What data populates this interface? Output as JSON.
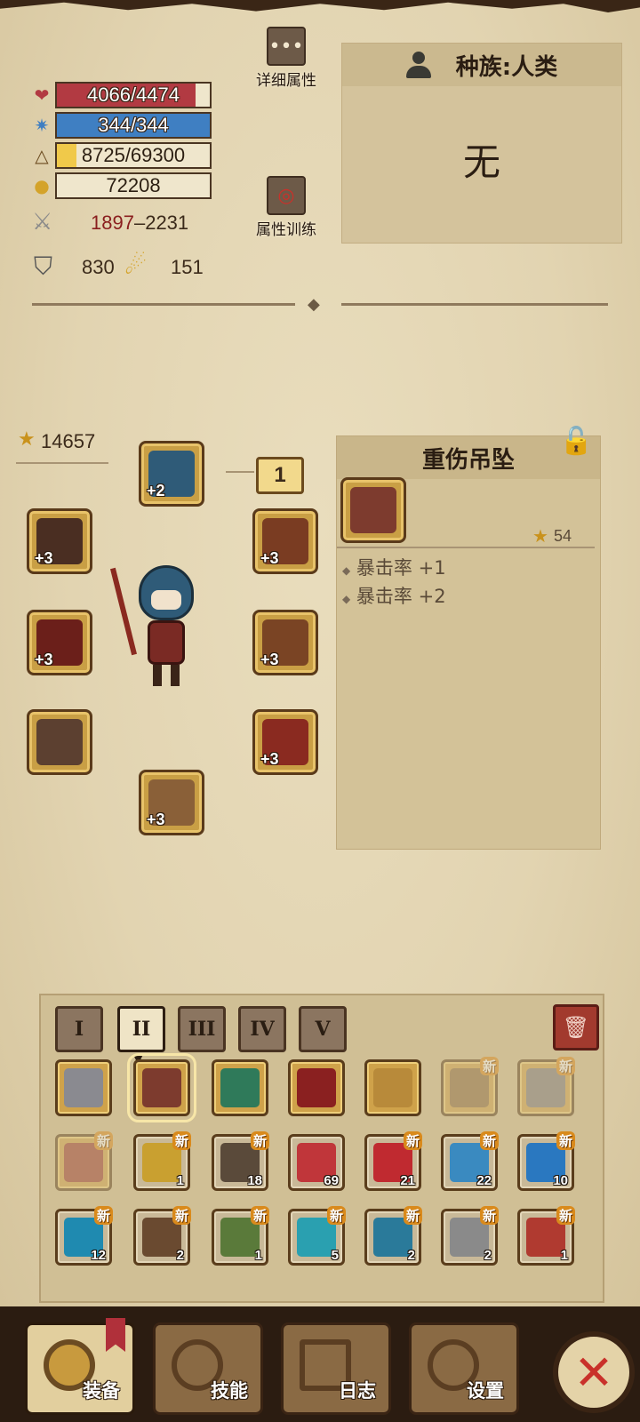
{
  "stats": {
    "hp": "4066/4474",
    "hp_fraction": 0.909,
    "mp": "344/344",
    "mp_fraction": 1.0,
    "xp": "8725/69300",
    "xp_fraction": 0.126,
    "gold": "72208",
    "attack_min": "1897",
    "attack_sep": "–",
    "attack_max": "2231",
    "armor": "830",
    "dodge": "151"
  },
  "buttons": {
    "details_label": "详细属性",
    "training_label": "属性训练"
  },
  "race": {
    "title": "种族:人类",
    "value": "无"
  },
  "equipment": {
    "total_power": "14657",
    "level_badge": "1",
    "slots": [
      {
        "name": "helmet",
        "plus": "+2",
        "color": "#2f5b78"
      },
      {
        "name": "gloves",
        "plus": "+3",
        "color": "#4a2e22"
      },
      {
        "name": "necklace",
        "plus": "+3",
        "color": "#7a3c22"
      },
      {
        "name": "weapon",
        "plus": "+3",
        "color": "#6b1f1a"
      },
      {
        "name": "armor",
        "plus": "+3",
        "color": "#7a4424"
      },
      {
        "name": "offhand",
        "plus": "",
        "color": "#5c4030"
      },
      {
        "name": "cloak",
        "plus": "+3",
        "color": "#8a2a20"
      },
      {
        "name": "boots",
        "plus": "+3",
        "color": "#8a6038"
      }
    ]
  },
  "detail": {
    "title": "重伤吊坠",
    "stars": "54",
    "attrs": [
      "暴击率 +1",
      "暴击率 +2"
    ]
  },
  "inventory": {
    "tabs": [
      "I",
      "II",
      "III",
      "IV",
      "V"
    ],
    "active_tab": 1,
    "new_label": "新",
    "rows": [
      [
        {
          "color": "#8a8a90",
          "count": "",
          "new": false,
          "faded": false,
          "gold": true
        },
        {
          "color": "#7d3b2e",
          "count": "",
          "new": false,
          "faded": false,
          "gold": true,
          "selected": true
        },
        {
          "color": "#2f7a5a",
          "count": "",
          "new": false,
          "faded": false,
          "gold": true
        },
        {
          "color": "#8a2020",
          "count": "",
          "new": false,
          "faded": false,
          "gold": true
        },
        {
          "color": "#b88a3a",
          "count": "",
          "new": false,
          "faded": false,
          "gold": true
        },
        {
          "color": "#8a6a40",
          "count": "",
          "new": true,
          "faded": true,
          "gold": true
        },
        {
          "color": "#7a7a80",
          "count": "",
          "new": true,
          "faded": true,
          "gold": true
        }
      ],
      [
        {
          "color": "#9a3a30",
          "count": "",
          "new": true,
          "faded": true,
          "gold": true
        },
        {
          "color": "#c9a030",
          "count": "1",
          "new": true,
          "faded": false,
          "gold": false
        },
        {
          "color": "#5a4a3a",
          "count": "18",
          "new": true,
          "faded": false,
          "gold": false
        },
        {
          "color": "#c0363a",
          "count": "69",
          "new": false,
          "faded": false,
          "gold": false
        },
        {
          "color": "#c02a30",
          "count": "21",
          "new": true,
          "faded": false,
          "gold": false
        },
        {
          "color": "#3a8ac0",
          "count": "22",
          "new": true,
          "faded": false,
          "gold": false
        },
        {
          "color": "#2a78c0",
          "count": "10",
          "new": true,
          "faded": false,
          "gold": false
        }
      ],
      [
        {
          "color": "#1f8ab0",
          "count": "12",
          "new": true,
          "faded": false,
          "gold": false
        },
        {
          "color": "#6a4a30",
          "count": "2",
          "new": true,
          "faded": false,
          "gold": false
        },
        {
          "color": "#5a7a3a",
          "count": "1",
          "new": true,
          "faded": false,
          "gold": false
        },
        {
          "color": "#2aa0b0",
          "count": "5",
          "new": true,
          "faded": false,
          "gold": false
        },
        {
          "color": "#2a7a9a",
          "count": "2",
          "new": true,
          "faded": false,
          "gold": false
        },
        {
          "color": "#8a8a8a",
          "count": "2",
          "new": true,
          "faded": false,
          "gold": false
        },
        {
          "color": "#b03a30",
          "count": "1",
          "new": true,
          "faded": false,
          "gold": false
        }
      ]
    ]
  },
  "nav": {
    "equip": "装备",
    "skills": "技能",
    "log": "日志",
    "settings": "设置",
    "close_glyph": "✕"
  },
  "colors": {
    "hp": "#b23a42",
    "mp": "#3f7fc2",
    "xp": "#f0c94a",
    "attack_min": "#8a1e1e"
  }
}
